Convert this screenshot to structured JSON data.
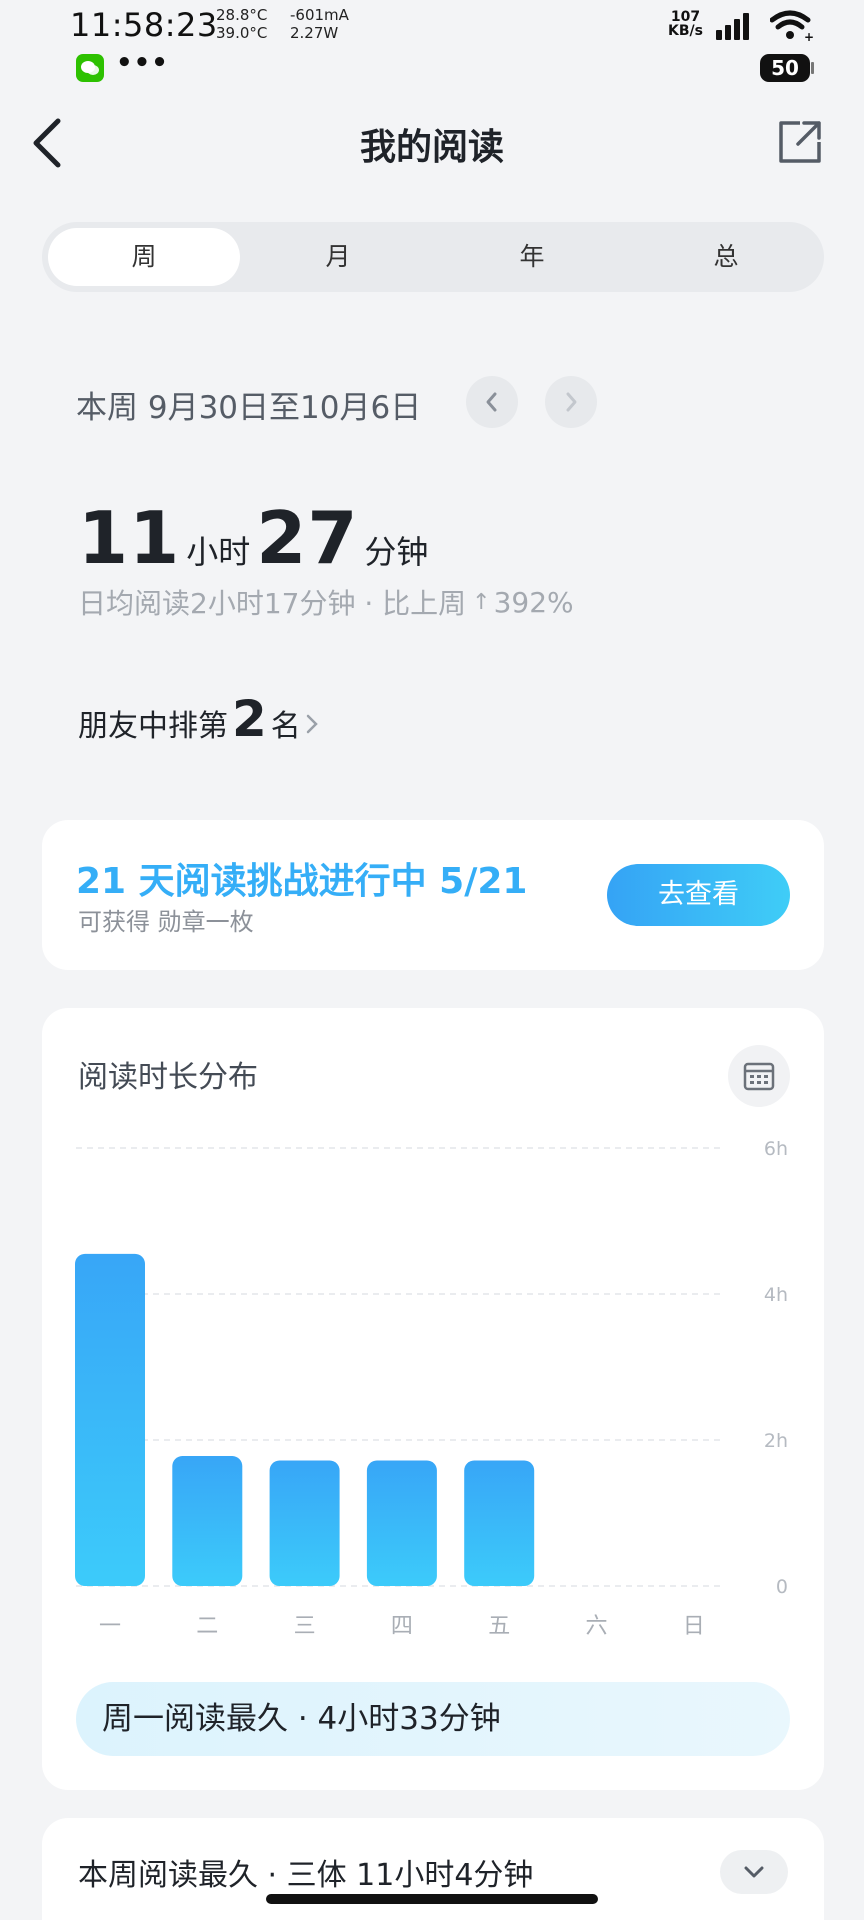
{
  "status_bar": {
    "time": "11:58:23",
    "temp1": "28.8°C",
    "temp2": "39.0°C",
    "current": "-601mA",
    "power": "2.27W",
    "more": "•••",
    "speed_value": "107",
    "speed_unit": "KB/s",
    "battery": "50"
  },
  "header": {
    "title": "我的阅读",
    "back_icon": "chevron-left-icon",
    "share_icon": "share-icon"
  },
  "tabs": [
    {
      "label": "周",
      "active": true
    },
    {
      "label": "月",
      "active": false
    },
    {
      "label": "年",
      "active": false
    },
    {
      "label": "总",
      "active": false
    }
  ],
  "period": {
    "range": "本周 9月30日至10月6日"
  },
  "totals": {
    "hours": "11",
    "hours_unit": "小时",
    "minutes": "27",
    "minutes_unit": "分钟",
    "daily_avg": "日均阅读2小时17分钟 · 比上周",
    "change_arrow": "↑",
    "change": "392%"
  },
  "rank": {
    "prefix": "朋友中排第",
    "value": "2",
    "suffix": "名"
  },
  "challenge": {
    "title": "21 天阅读挑战进行中 5/21",
    "subtitle": "可获得 勋章一枚",
    "button": "去查看"
  },
  "chart_section": {
    "title": "阅读时长分布",
    "calendar_icon": "calendar-icon",
    "summary": "周一阅读最久 · 4小时33分钟"
  },
  "chart_data": {
    "type": "bar",
    "categories": [
      "一",
      "二",
      "三",
      "四",
      "五",
      "六",
      "日"
    ],
    "values": [
      4.55,
      1.78,
      1.72,
      1.72,
      1.72,
      0,
      0
    ],
    "y_ticks": [
      "0",
      "2h",
      "4h",
      "6h"
    ],
    "ylim": [
      0,
      6
    ],
    "grid": true,
    "bar_color_top": "#38a6f7",
    "bar_color_bottom": "#3ccbfa"
  },
  "bottom": {
    "text": "本周阅读最久 · 三体 11小时4分钟"
  }
}
